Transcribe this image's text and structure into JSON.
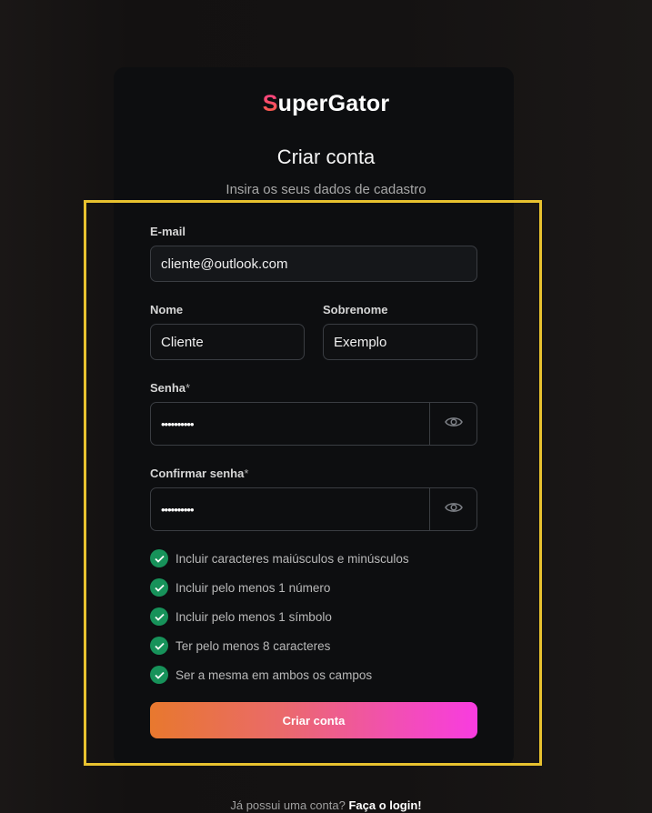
{
  "brand": {
    "logo_first": "S",
    "logo_rest": "uperGator"
  },
  "header": {
    "title": "Criar conta",
    "subtitle": "Insira os seus dados de cadastro"
  },
  "form": {
    "email_label": "E-mail",
    "email_value": "cliente@outlook.com",
    "first_name_label": "Nome",
    "first_name_value": "Cliente",
    "last_name_label": "Sobrenome",
    "last_name_value": "Exemplo",
    "password_label": "Senha",
    "password_required": "*",
    "password_value": "••••••••••",
    "confirm_label": "Confirmar senha",
    "confirm_required": "*",
    "confirm_value": "••••••••••",
    "eye_icon": "eye-icon"
  },
  "requirements": [
    {
      "text": "Incluir caracteres maiúsculos e minúsculos",
      "met": true
    },
    {
      "text": "Incluir pelo menos 1 número",
      "met": true
    },
    {
      "text": "Incluir pelo menos 1 símbolo",
      "met": true
    },
    {
      "text": "Ter pelo menos 8 caracteres",
      "met": true
    },
    {
      "text": "Ser a mesma em ambos os campos",
      "met": true
    }
  ],
  "submit_label": "Criar conta",
  "footer": {
    "prompt": "Já possui uma conta?",
    "link": "Faça o login!"
  },
  "colors": {
    "check_green": "#17925a",
    "highlight": "#e8c22f",
    "button_gradient": [
      "#e8782e",
      "#f83ce0"
    ]
  }
}
